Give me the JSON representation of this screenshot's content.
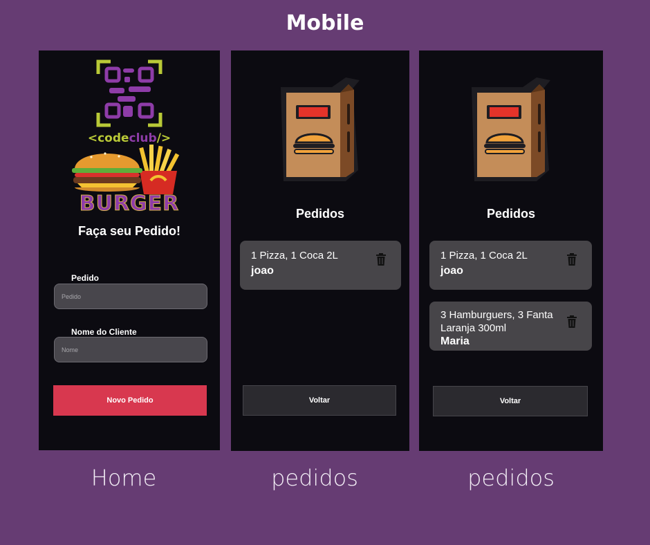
{
  "title": "Mobile",
  "home": {
    "caption": "Home",
    "logo_code": "<code",
    "logo_club": "club",
    "logo_end": "/>",
    "logo_burger": "BURGER",
    "heading": "Faça seu Pedido!",
    "pedido_label": "Pedido",
    "pedido_placeholder": "Pedido",
    "nome_label": "Nome do Cliente",
    "nome_placeholder": "Nome",
    "novo_pedido_button": "Novo Pedido"
  },
  "pedidos_one": {
    "caption": "pedidos",
    "heading": "Pedidos",
    "orders": [
      {
        "items": "1 Pizza, 1 Coca 2L",
        "client": "joao"
      }
    ],
    "voltar_button": "Voltar"
  },
  "pedidos_two": {
    "caption": "pedidos",
    "heading": "Pedidos",
    "orders": [
      {
        "items": "1 Pizza, 1 Coca 2L",
        "client": "joao"
      },
      {
        "items": "3 Hamburguers, 3 Fanta Laranja 300ml",
        "client": "Maria"
      }
    ],
    "voltar_button": "Voltar"
  },
  "colors": {
    "background": "#663c73",
    "screen": "#0c0b11",
    "accent_button": "#d8384f",
    "card": "#474549"
  },
  "icons": [
    "qr-logo-icon",
    "burger-fries-icon",
    "takeaway-bag-icon",
    "trash-icon"
  ]
}
